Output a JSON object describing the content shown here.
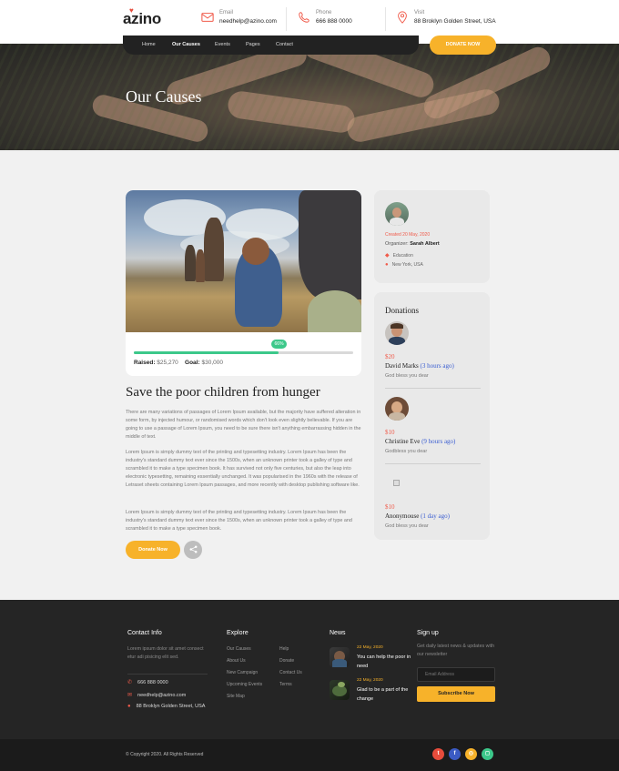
{
  "brand": {
    "logo": "azino",
    "accent": "#f7b22a",
    "red": "#f05b4b",
    "green": "#3cc88a"
  },
  "header": {
    "email": {
      "icon": "mail-icon",
      "label": "Email",
      "value": "needhelp@azino.com"
    },
    "phone": {
      "icon": "phone-icon",
      "label": "Phone",
      "value": "666 888 0000"
    },
    "visit": {
      "icon": "map-pin-icon",
      "label": "Visit",
      "value": "88 Broklyn Golden Street, USA"
    },
    "donate_label": "DONATE NOW"
  },
  "nav": {
    "items": [
      "Home",
      "Our Causes",
      "Events",
      "Pages",
      "Contact"
    ],
    "active": "Our Causes"
  },
  "hero": {
    "title": "Our Causes"
  },
  "cause": {
    "progress_percent": 66,
    "progress_label": "66%",
    "raised_label": "Raised:",
    "raised_value": "$25,270",
    "goal_label": "Goal:",
    "goal_value": "$30,000",
    "title": "Save the poor children from hunger",
    "paragraphs": [
      "There are many variations of passages of Lorem Ipsum available, but the majority have suffered alteration in some form, by injected humour, or randomised words which don't look even slightly believable. If you are going to use a passage of Lorem Ipsum, you need to be sure there isn't anything embarrassing hidden in the middle of text.",
      "Lorem Ipsum is simply dummy text of the printing and typesetting industry. Lorem Ipsum has been the industry's standard dummy text ever since the 1500s, when an unknown printer took a galley of type and scrambled it to make a type specimen book. It has survived not only five centuries, but also the leap into electronic typesetting, remaining essentially unchanged. It was popularised in the 1960s with the release of Letraset sheets containing Lorem Ipsum passages, and more recently with desktop publishing software like.",
      "Lorem Ipsum is simply dummy text of the printing and typesetting industry. Lorem Ipsum has been the industry's standard dummy text ever since the 1500s, when an unknown printer took a galley of type and scrambled it to make a type specimen book."
    ],
    "donate_button": "Donate Now",
    "share_icon": "share-icon"
  },
  "info": {
    "created": "Created 20 May, 2020",
    "organizer_label": "Organizer:",
    "organizer_name": "Sarah Albert",
    "category": "Education",
    "location": "New York, USA"
  },
  "donations": {
    "title": "Donations",
    "items": [
      {
        "amount": "$20",
        "name": "David Marks",
        "ago": "(3 hours ago)",
        "message": "God bless you dear"
      },
      {
        "amount": "$10",
        "name": "Christine Eve",
        "ago": "(9 hours ago)",
        "message": "Godbless you dear"
      },
      {
        "amount": "$10",
        "name": "Anonymouse",
        "ago": "(1 day ago)",
        "message": "God bless you dear"
      }
    ]
  },
  "footer": {
    "contact": {
      "title": "Contact Info",
      "text": "Lorem ipsum dolor sit amet consect etur adi pisicing elit sed.",
      "phone": "666 888 0000",
      "email": "needhelp@azino.com",
      "address": "88 Broklyn Golden Street, USA"
    },
    "explore": {
      "title": "Explore",
      "col1": [
        "Our Causes",
        "About Us",
        "New Campaign",
        "Upcoming Events",
        "Site Map"
      ],
      "col2": [
        "Help",
        "Donate",
        "Contact Us",
        "Terms"
      ]
    },
    "news": {
      "title": "News",
      "items": [
        {
          "date": "22 May, 2020",
          "text": "You can help the poor in need"
        },
        {
          "date": "22 May, 2020",
          "text": "Glad to be a part of the change"
        }
      ]
    },
    "signup": {
      "title": "Sign up",
      "text": "Get daily latest news & updates with our newsletter",
      "placeholder": "Email Address",
      "button": "Subscribe Now"
    },
    "copyright": "© Copyright 2020. All Rights Reserved",
    "social": [
      "twitter-icon",
      "facebook-icon",
      "dribbble-icon",
      "instagram-icon"
    ]
  }
}
